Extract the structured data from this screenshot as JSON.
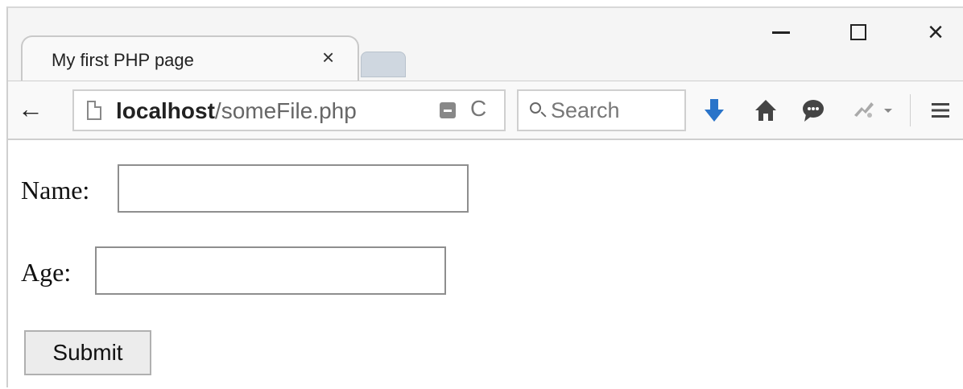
{
  "window": {
    "tab_title": "My first PHP page",
    "tab_close": "×",
    "close": "×"
  },
  "toolbar": {
    "back": "←",
    "reload": "C",
    "url_host": "localhost",
    "url_path": "/someFile.php",
    "search_placeholder": "Search",
    "accent_download": "#2a74c9"
  },
  "form": {
    "name_label": "Name:",
    "name_value": "",
    "age_label": "Age:",
    "age_value": "",
    "submit_label": "Submit"
  },
  "icons": [
    "back-arrow-icon",
    "page-icon",
    "reader-view-icon",
    "reload-icon",
    "search-icon",
    "download-icon",
    "home-icon",
    "chat-icon",
    "extension-icon",
    "dropdown-icon",
    "hamburger-menu-icon"
  ]
}
